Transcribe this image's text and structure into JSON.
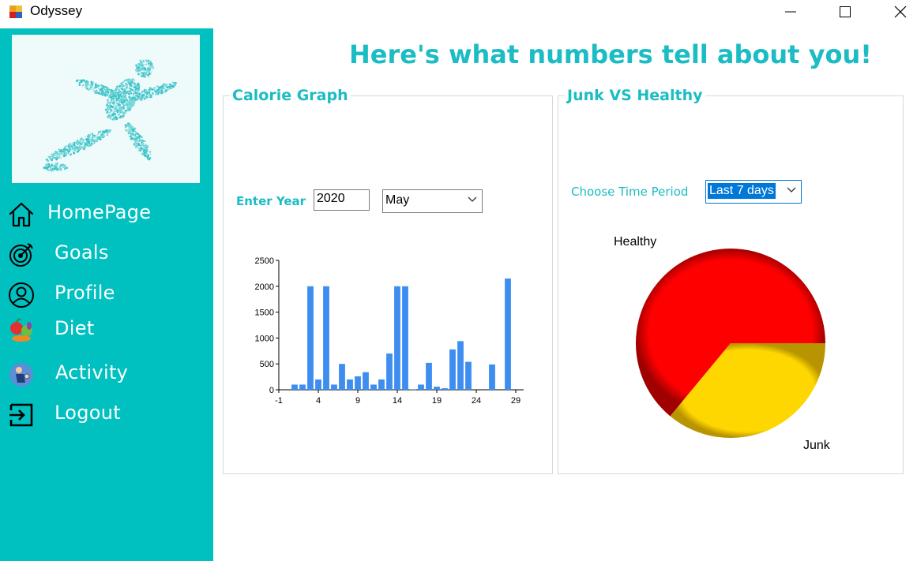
{
  "window": {
    "title": "Odyssey",
    "minimize_icon": "minimize-icon",
    "maximize_icon": "maximize-icon",
    "close_icon": "close-icon"
  },
  "sidebar": {
    "image": "runner-silhouette",
    "items": [
      {
        "label": "HomePage",
        "icon": "home-icon"
      },
      {
        "label": "Goals",
        "icon": "target-icon"
      },
      {
        "label": "Profile",
        "icon": "user-icon"
      },
      {
        "label": "Diet",
        "icon": "fruit-icon"
      },
      {
        "label": "Activity",
        "icon": "activity-icon"
      },
      {
        "label": "Logout",
        "icon": "logout-icon"
      }
    ]
  },
  "main": {
    "title": "Here's what numbers tell about you!",
    "calorie_group": {
      "title": "Calorie Graph",
      "year_label": "Enter Year",
      "year_value": "2020",
      "month_value": "May"
    },
    "junk_group": {
      "title": "Junk VS Healthy",
      "period_label": "Choose Time Period",
      "period_value": "Last 7 days"
    }
  },
  "colors": {
    "accent": "#00C0C0",
    "bar": "#3d8ef0",
    "healthy": "#ff0000",
    "junk": "#ffd700"
  },
  "chart_data": [
    {
      "type": "bar",
      "x": [
        1,
        2,
        3,
        4,
        5,
        6,
        7,
        8,
        9,
        10,
        11,
        12,
        13,
        14,
        15,
        16,
        17,
        18,
        19,
        20,
        21,
        22,
        23,
        24,
        25,
        26,
        27,
        28,
        29
      ],
      "values": [
        100,
        100,
        2000,
        200,
        2000,
        100,
        500,
        200,
        260,
        340,
        100,
        200,
        700,
        2000,
        2000,
        10,
        100,
        520,
        60,
        30,
        780,
        940,
        540,
        0,
        0,
        490,
        0,
        2150,
        0
      ],
      "xticks": [
        "-1",
        "4",
        "9",
        "14",
        "19",
        "24",
        "29"
      ],
      "yticks": [
        "0",
        "500",
        "1000",
        "1500",
        "2000",
        "2500"
      ],
      "xlim": [
        -1,
        30
      ],
      "ylim": [
        0,
        2500
      ],
      "grid": false
    },
    {
      "type": "pie",
      "labels": [
        "Healthy",
        "Junk"
      ],
      "values": [
        64,
        36
      ],
      "colors": [
        "#ff0000",
        "#ffd700"
      ]
    }
  ]
}
